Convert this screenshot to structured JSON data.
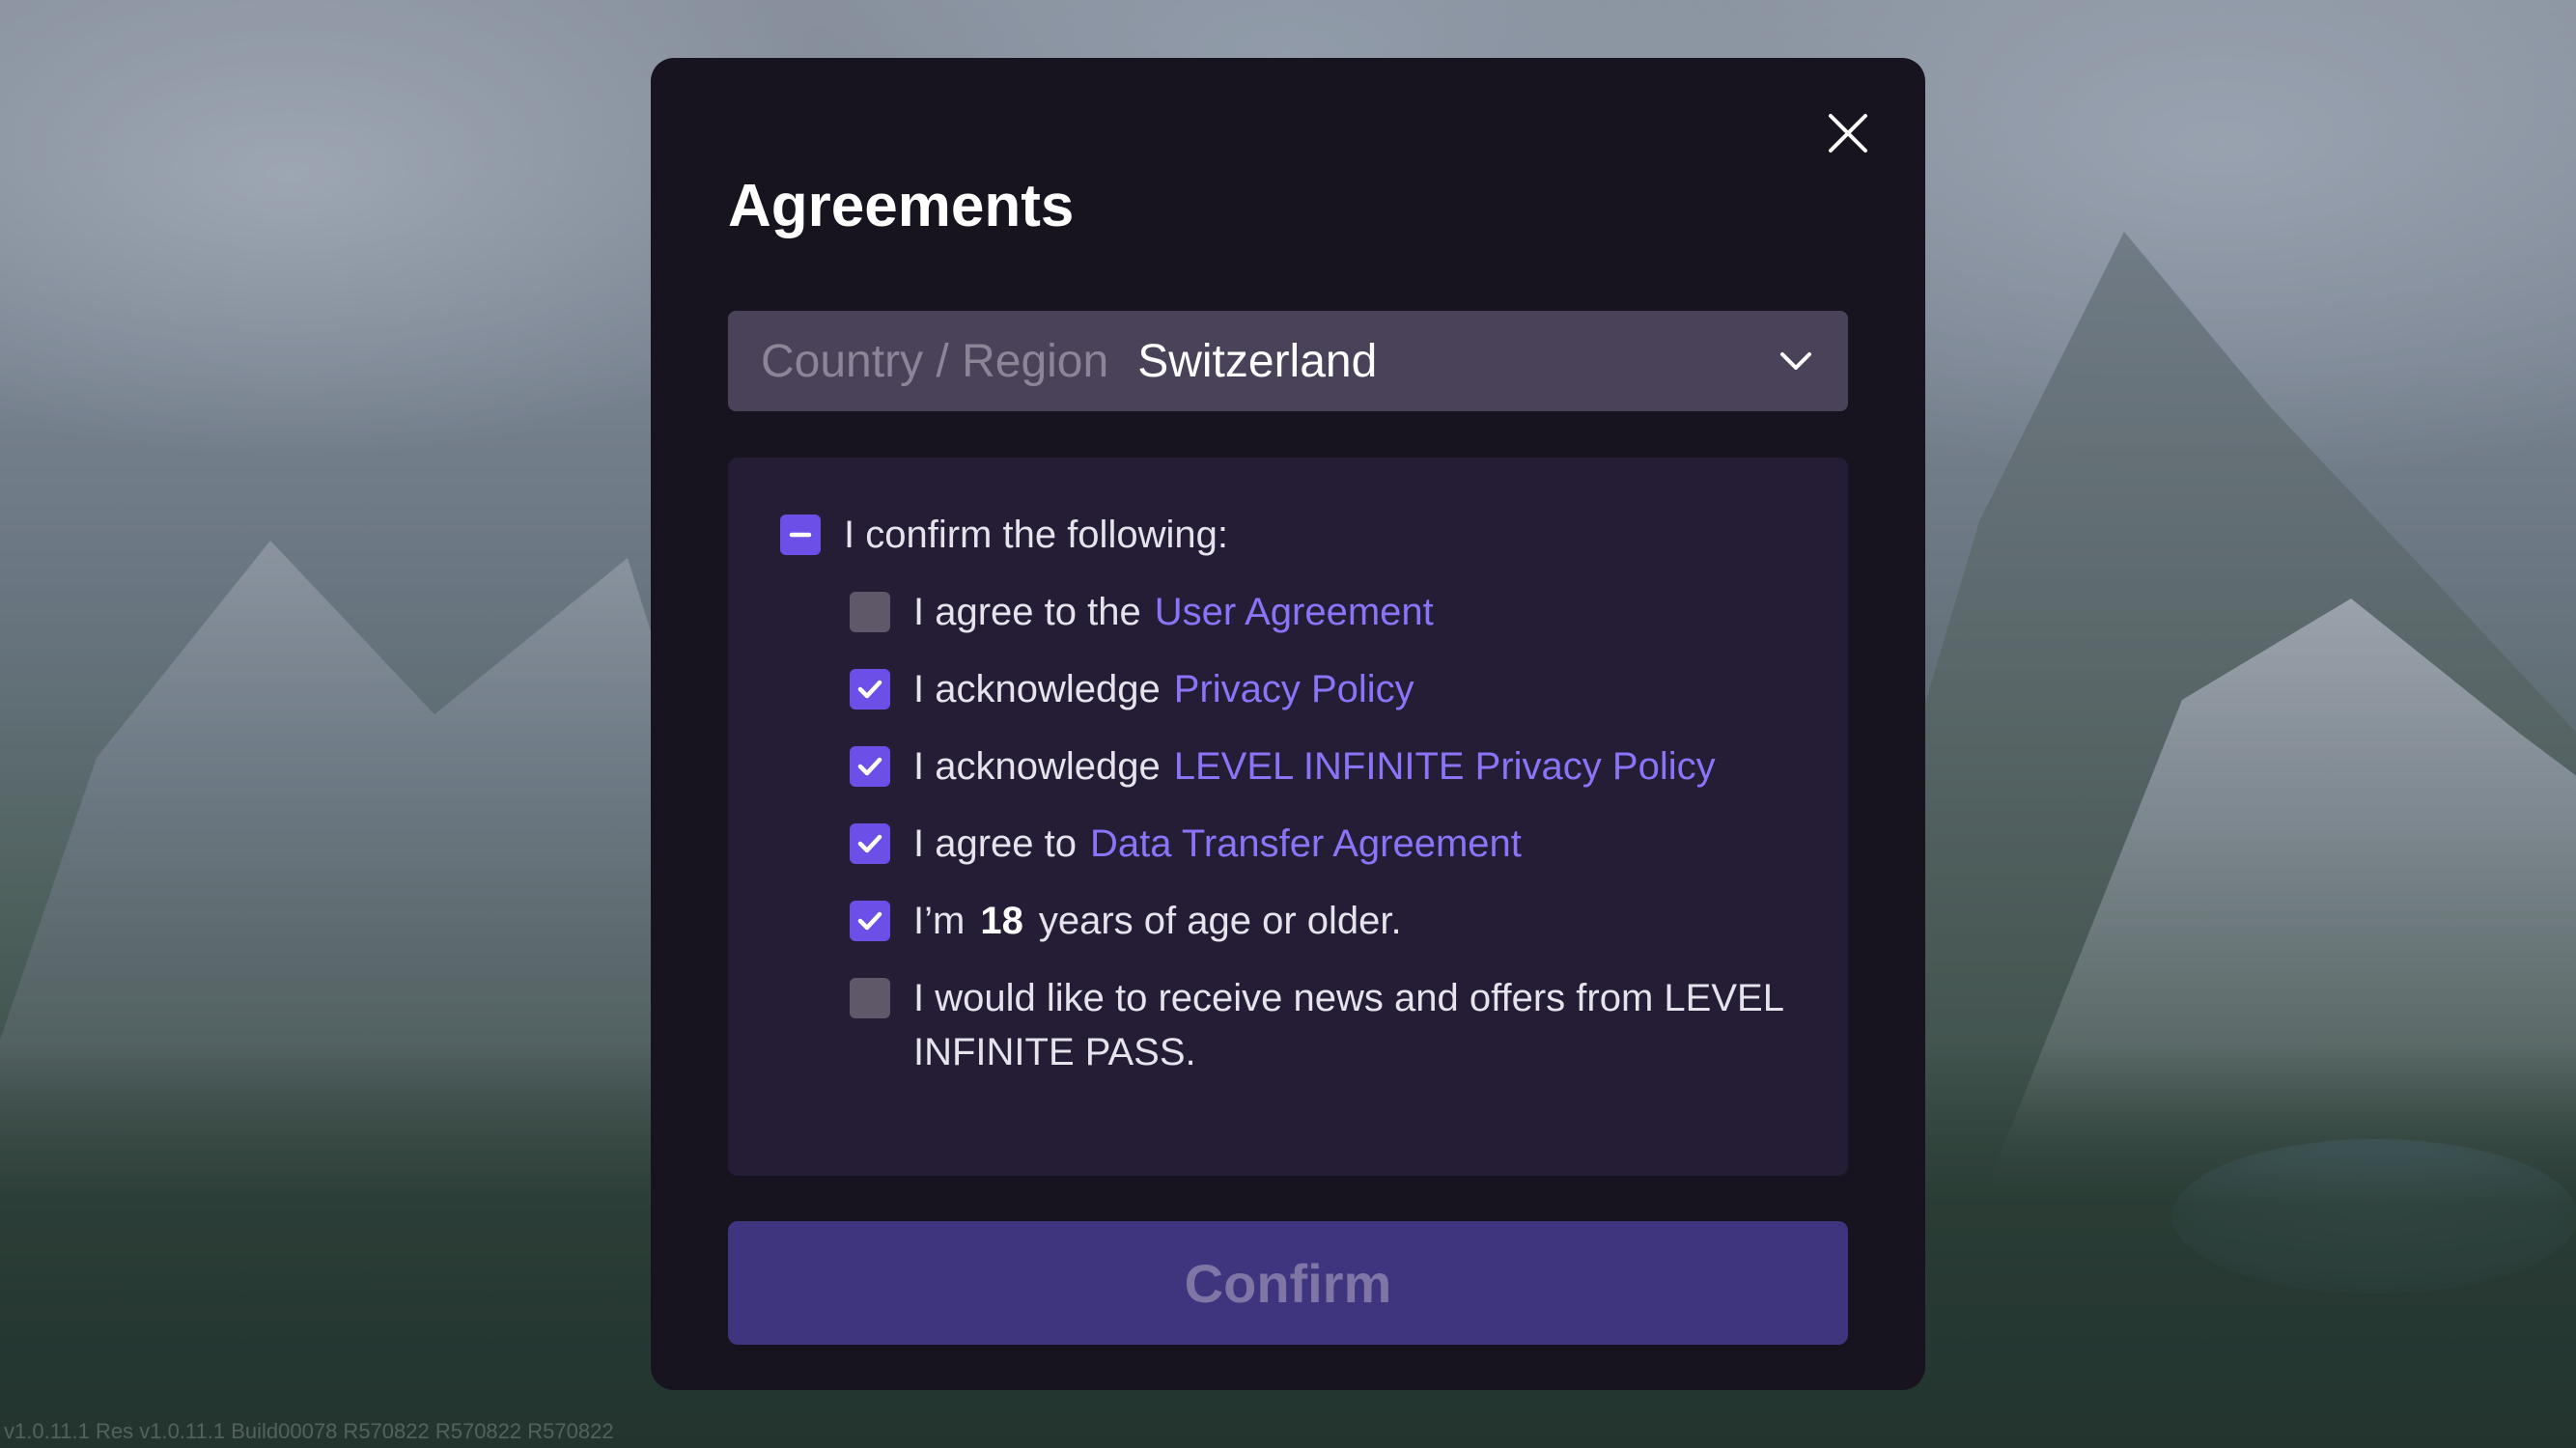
{
  "dialog": {
    "title": "Agreements",
    "close_icon": "close-icon"
  },
  "region": {
    "label": "Country / Region",
    "value": "Switzerland",
    "icon": "chevron-down-icon"
  },
  "agreements": {
    "master": {
      "label": "I confirm the following:",
      "state": "indeterminate"
    },
    "items": [
      {
        "prefix": "I agree to the",
        "link": "User Agreement",
        "checked": false
      },
      {
        "prefix": "I acknowledge",
        "link": "Privacy Policy",
        "checked": true
      },
      {
        "prefix": "I acknowledge",
        "link": "LEVEL INFINITE Privacy Policy",
        "checked": true
      },
      {
        "prefix": "I agree to",
        "link": "Data Transfer Agreement",
        "checked": true
      }
    ],
    "age": {
      "prefix": "I’m",
      "age": "18",
      "suffix": "years of age or older.",
      "checked": true
    },
    "news": {
      "label": "I would like to receive news and offers from LEVEL INFINITE PASS.",
      "checked": false
    }
  },
  "confirm": {
    "label": "Confirm"
  },
  "footer": {
    "build": "v1.0.11.1 Res v1.0.11.1 Build00078 R570822 R570822 R570822"
  },
  "colors": {
    "accent": "#6b4fe6",
    "link": "#8b74f7",
    "modal_bg": "#17141f",
    "panel_bg": "#241d35",
    "button_bg": "#3f347e"
  }
}
